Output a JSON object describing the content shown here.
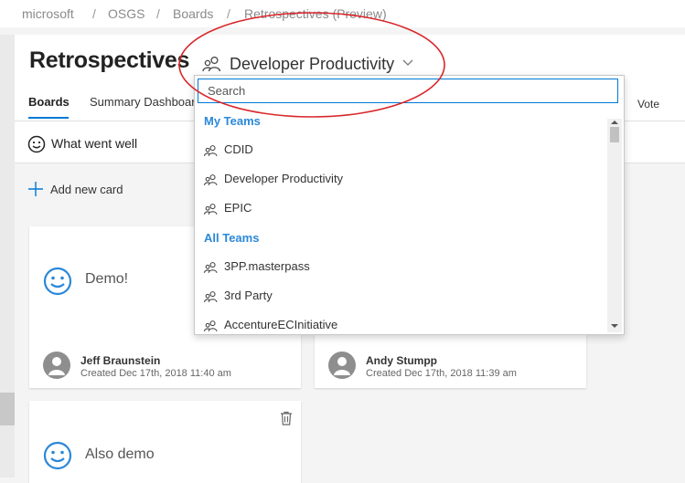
{
  "breadcrumb": {
    "items": [
      "microsoft",
      "OSGS",
      "Boards",
      "Retrospectives (Preview)"
    ],
    "separator": "/"
  },
  "header": {
    "title": "Retrospectives",
    "team_selector": {
      "label": "Developer Productivity",
      "icon": "team-icon",
      "chevron": "chevron-down-icon"
    },
    "tabs": [
      {
        "label": "Boards",
        "active": true
      },
      {
        "label": "Summary Dashboard",
        "active": false
      }
    ],
    "right_label": "Vote"
  },
  "column": {
    "title": "What went well",
    "icon": "smiley-icon"
  },
  "add_card": {
    "label": "Add new card",
    "icon": "plus-icon"
  },
  "cards": [
    {
      "text": "Demo!",
      "author": "Jeff Braunstein",
      "created": "Created Dec 17th, 2018 11:40 am"
    },
    {
      "text": "",
      "author": "Andy Stumpp",
      "created": "Created Dec 17th, 2018 11:39 am"
    },
    {
      "text": "Also demo",
      "author": "",
      "created": "",
      "action_icon": "trash-icon"
    }
  ],
  "dropdown": {
    "search_placeholder": "Search",
    "groups": [
      {
        "label": "My Teams",
        "items": [
          "CDID",
          "Developer Productivity",
          "EPIC"
        ]
      },
      {
        "label": "All Teams",
        "items": [
          "3PP.masterpass",
          "3rd Party",
          "AccentureECInitiative"
        ]
      }
    ]
  },
  "colors": {
    "accent": "#0078d4",
    "group_label": "#2b88d8",
    "smiley": "#2b88d8",
    "annotation": "#d9262b"
  }
}
